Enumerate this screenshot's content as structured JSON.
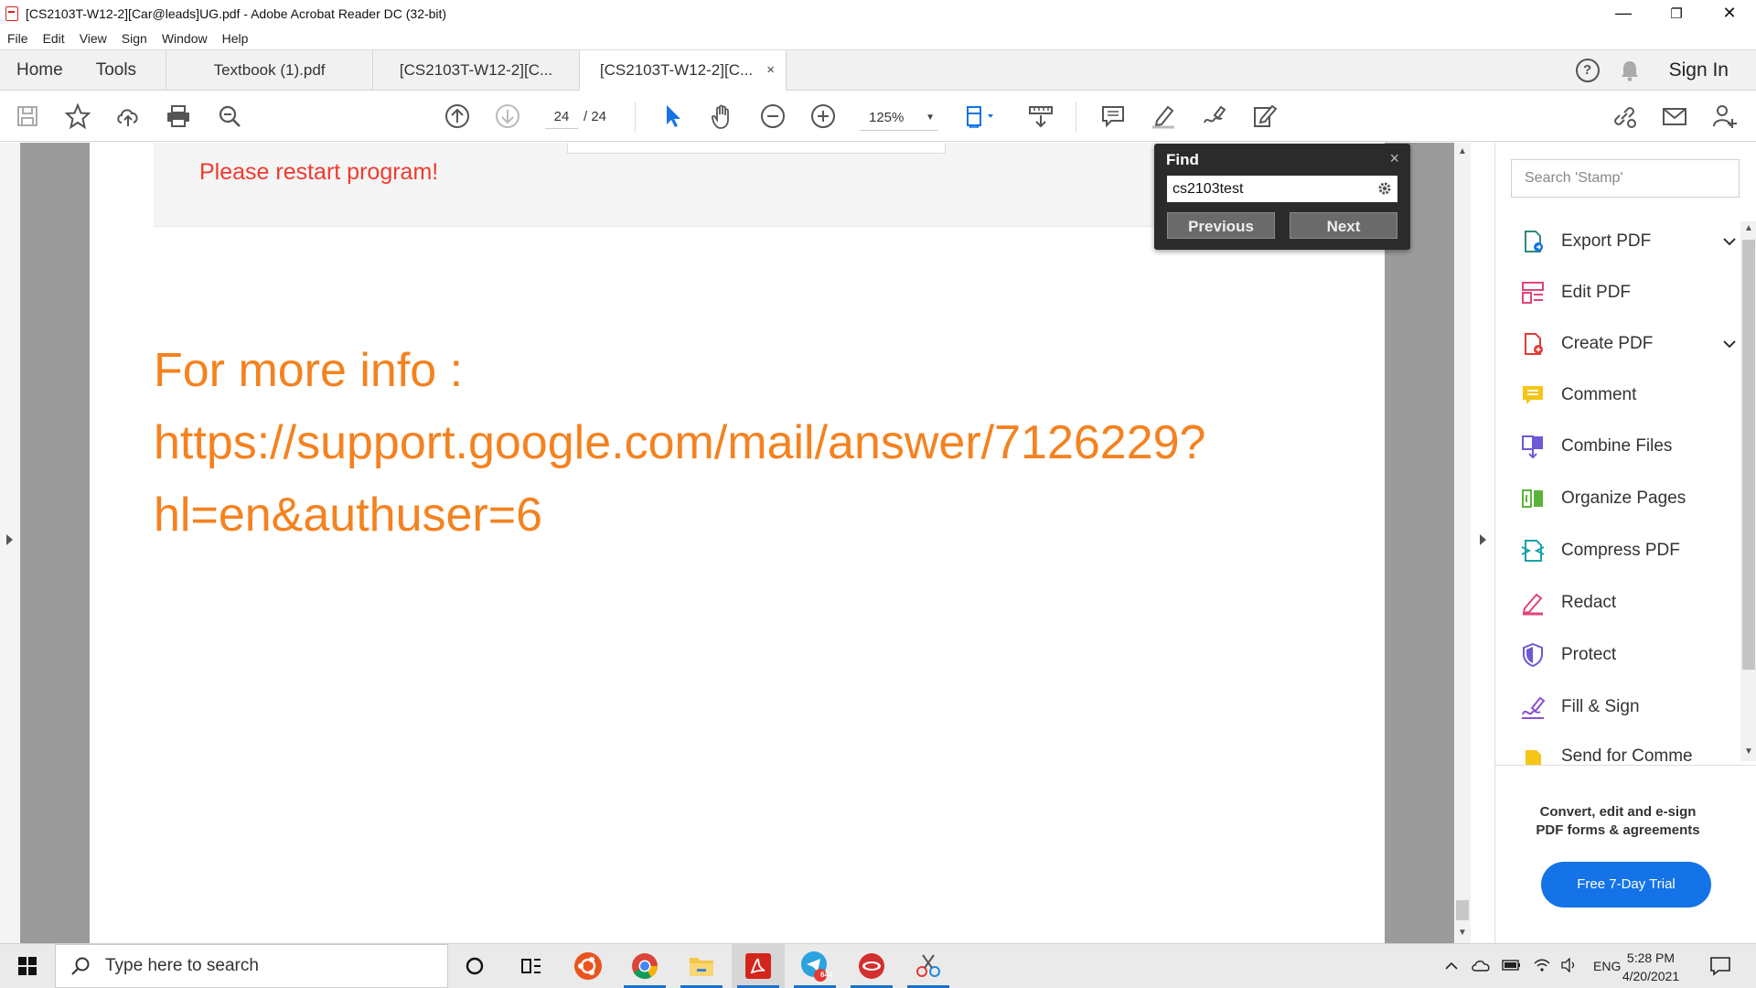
{
  "window": {
    "title": "[CS2103T-W12-2][Car@leads]UG.pdf - Adobe Acrobat Reader DC (32-bit)",
    "minimize": "—",
    "restore": "❐",
    "close": "✕"
  },
  "menu": [
    "File",
    "Edit",
    "View",
    "Sign",
    "Window",
    "Help"
  ],
  "tabs": {
    "home": "Home",
    "tools": "Tools",
    "docs": [
      {
        "label": "Textbook (1).pdf"
      },
      {
        "label": "[CS2103T-W12-2][C..."
      },
      {
        "label": "[CS2103T-W12-2][C...",
        "close": "×"
      }
    ],
    "help": "?",
    "sign_in": "Sign In"
  },
  "toolbar": {
    "page_current": "24",
    "page_total": "/  24",
    "zoom": "125%",
    "zoom_caret": "▼"
  },
  "document": {
    "restart_text": "Please restart program!",
    "info_line1": "For more info :",
    "info_line2": "https://support.google.com/mail/answer/7126229?",
    "info_line3": "hl=en&authuser=6",
    "colors": {
      "restart": "#f03a2e",
      "info": "#f4821f"
    }
  },
  "find": {
    "title": "Find",
    "close": "×",
    "query": "cs2103test",
    "previous": "Previous",
    "next": "Next"
  },
  "tools_panel": {
    "search_placeholder": "Search 'Stamp'",
    "items": [
      {
        "label": "Export PDF",
        "icon": "export-pdf-icon",
        "expandable": true
      },
      {
        "label": "Edit PDF",
        "icon": "edit-pdf-icon"
      },
      {
        "label": "Create PDF",
        "icon": "create-pdf-icon",
        "expandable": true
      },
      {
        "label": "Comment",
        "icon": "comment-icon"
      },
      {
        "label": "Combine Files",
        "icon": "combine-files-icon"
      },
      {
        "label": "Organize Pages",
        "icon": "organize-pages-icon"
      },
      {
        "label": "Compress PDF",
        "icon": "compress-pdf-icon"
      },
      {
        "label": "Redact",
        "icon": "redact-icon"
      },
      {
        "label": "Protect",
        "icon": "protect-icon"
      },
      {
        "label": "Fill & Sign",
        "icon": "fill-sign-icon"
      },
      {
        "label": "Send for Comme",
        "icon": "send-for-comment-icon"
      }
    ],
    "chevron": "⌄",
    "promo": "Convert, edit and e-sign PDF forms & agreements",
    "trial_button": "Free 7-Day Trial"
  },
  "taskbar": {
    "search_placeholder": "Type here to search",
    "telegram_badge": "644",
    "language": "ENG",
    "time": "5:28 PM",
    "date": "4/20/2021"
  }
}
